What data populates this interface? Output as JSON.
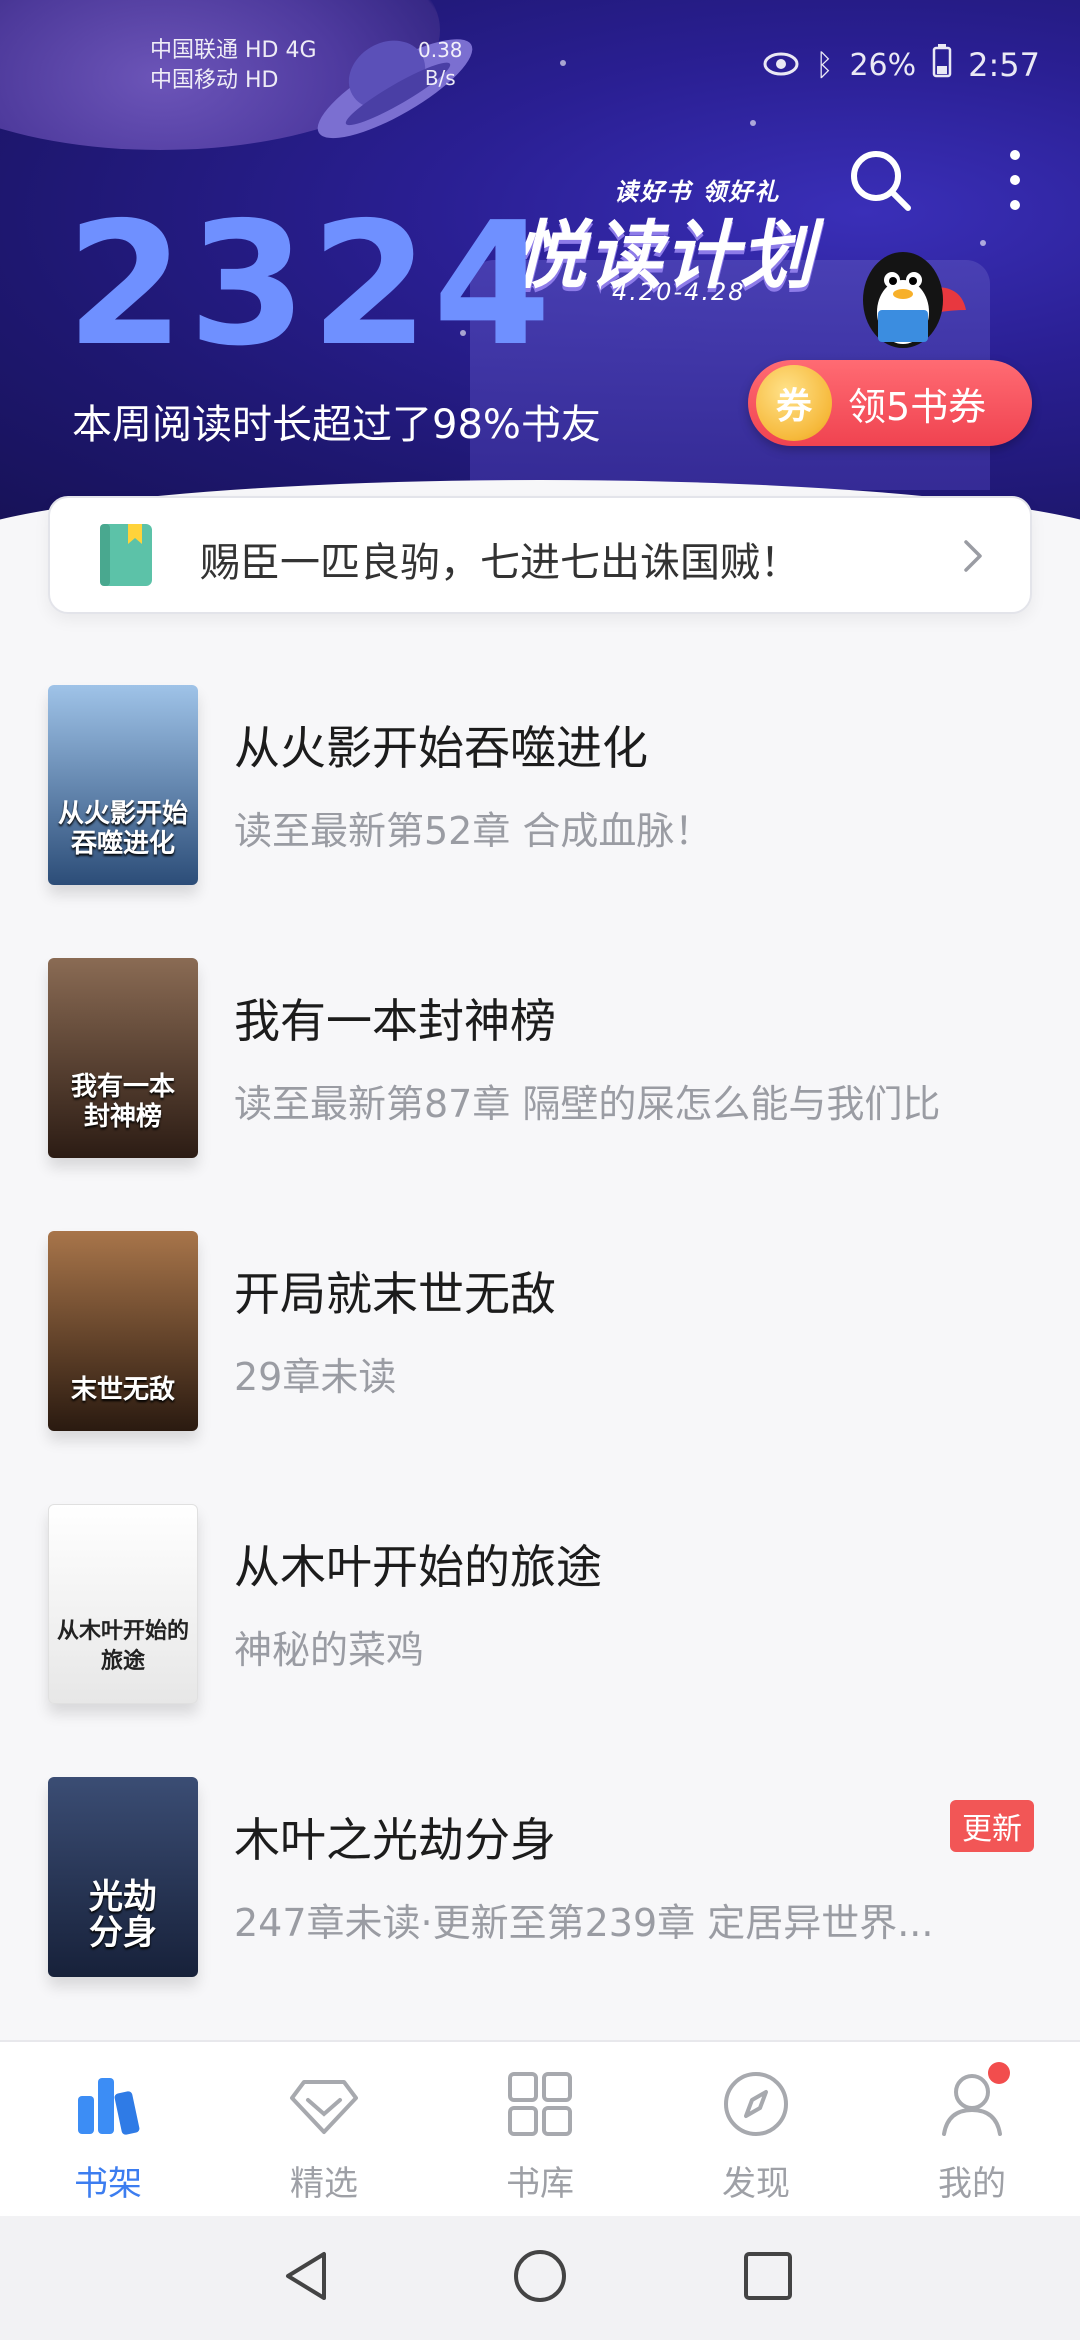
{
  "status_bar": {
    "carrier1": "中国联通 HD 4G",
    "carrier2": "中国移动 HD",
    "net_speed": "0.38\nB/s",
    "battery": "26%",
    "time": "2:57"
  },
  "banner": {
    "read_count": "2324",
    "read_desc": "本周阅读时长超过了98%书友",
    "promo_tag": "读好书 领好礼",
    "promo_title": "悦读计划",
    "promo_dates": "4.20-4.28",
    "coupon_coin": "券",
    "coupon_label": "领5书券"
  },
  "notice": {
    "text": "赐臣一匹良驹，七进七出诛国贼！"
  },
  "books": [
    {
      "title": "从火影开始吞噬进化",
      "subtitle": "读至最新第52章  合成血脉！",
      "cover_text": "从火影开始\n吞噬进化",
      "cover_color_top": "#9fc3e8",
      "cover_color_bottom": "#2c4d78",
      "badge": ""
    },
    {
      "title": "我有一本封神榜",
      "subtitle": "读至最新第87章 隔壁的屎怎么能与我们比",
      "cover_text": "我有一本\n封神榜",
      "cover_color_top": "#8a6b54",
      "cover_color_bottom": "#2c1c14",
      "badge": ""
    },
    {
      "title": "开局就末世无敌",
      "subtitle": "29章未读",
      "cover_text": "末世无敌",
      "cover_color_top": "#a8754a",
      "cover_color_bottom": "#2a1a10",
      "badge": ""
    },
    {
      "title": "从木叶开始的旅途",
      "subtitle": "神秘的菜鸡",
      "cover_text": "从木叶开始的\n旅途",
      "cover_color_top": "#ffffff",
      "cover_color_bottom": "#e7e7e7",
      "badge": ""
    },
    {
      "title": "木叶之光劫分身",
      "subtitle": "247章未读·更新至第239章 定居异世界...",
      "cover_text": "光劫\n分身",
      "cover_color_top": "#3b4d74",
      "cover_color_bottom": "#17213a",
      "badge": "更新"
    }
  ],
  "tabs": [
    {
      "label": "书架",
      "icon": "bookshelf-icon",
      "active": true
    },
    {
      "label": "精选",
      "icon": "diamond-icon",
      "active": false
    },
    {
      "label": "书库",
      "icon": "grid-icon",
      "active": false
    },
    {
      "label": "发现",
      "icon": "compass-icon",
      "active": false
    },
    {
      "label": "我的",
      "icon": "user-icon",
      "active": false
    }
  ],
  "colors": {
    "accent": "#3c7df0",
    "badge": "#f25656",
    "coupon": "#f04350",
    "banner_bg": "#1e1770"
  }
}
